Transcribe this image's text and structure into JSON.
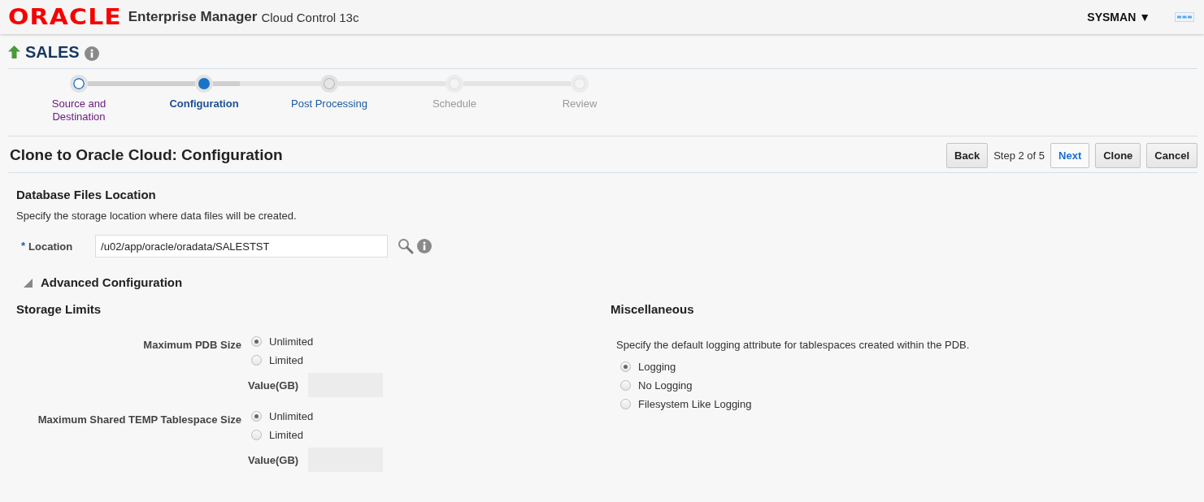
{
  "header": {
    "brand": "ORACLE",
    "product": "Enterprise Manager",
    "edition": "Cloud Control 13c",
    "user": "SYSMAN ▼"
  },
  "target": {
    "name": "SALES",
    "up": true
  },
  "train": [
    {
      "label": "Source and Destination",
      "selected": false,
      "visited": true,
      "disabled": false
    },
    {
      "label": "Configuration",
      "selected": true,
      "visited": false,
      "disabled": false
    },
    {
      "label": "Post Processing",
      "selected": false,
      "visited": false,
      "disabled": false
    },
    {
      "label": "Schedule",
      "selected": false,
      "visited": false,
      "disabled": true
    },
    {
      "label": "Review",
      "selected": false,
      "visited": false,
      "disabled": true
    }
  ],
  "page_title": "Clone to Oracle Cloud: Configuration",
  "nav": {
    "back": "Back",
    "step": "Step 2 of 5",
    "next": "Next",
    "buttons": [
      "Clone",
      "Cancel"
    ]
  },
  "files_section": {
    "heading": "Database Files Location",
    "description": "Specify the storage location where data files will be created.",
    "required_mark": "*",
    "label": "Location",
    "value": "/u02/app/oracle/oradata/SALESTST"
  },
  "advanced": {
    "label": "Advanced Configuration",
    "expanded": true
  },
  "storage": {
    "heading": "Storage Limits",
    "groups": [
      {
        "label": "Maximum PDB Size",
        "options": [
          {
            "label": "Unlimited",
            "selected": true
          },
          {
            "label": "Limited",
            "selected": false
          }
        ],
        "value_label": "Value(GB)",
        "value_disabled": true
      },
      {
        "label": "Maximum Shared TEMP Tablespace Size",
        "options": [
          {
            "label": "Unlimited",
            "selected": true
          },
          {
            "label": "Limited",
            "selected": false
          }
        ],
        "value_label": "Value(GB)",
        "value_disabled": true
      }
    ]
  },
  "misc": {
    "heading": "Miscellaneous",
    "description": "Specify the default logging attribute for tablespaces created within the PDB.",
    "options": [
      {
        "label": "Logging",
        "selected": true
      },
      {
        "label": "No Logging",
        "selected": false
      },
      {
        "label": "Filesystem Like Logging",
        "selected": false
      }
    ]
  }
}
